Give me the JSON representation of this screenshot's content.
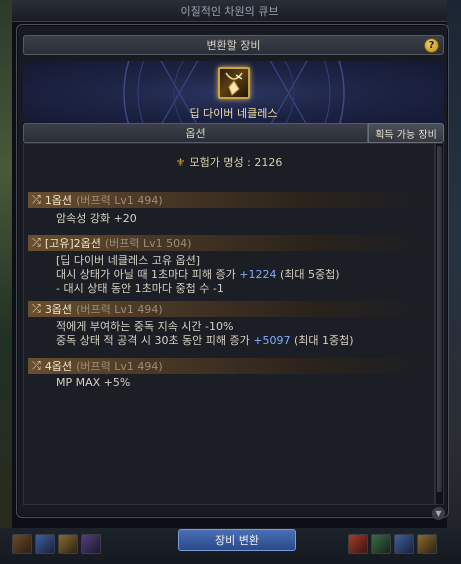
{
  "window": {
    "title": "이질적인 차원의 큐브"
  },
  "convert_section": {
    "title": "변환할 장비",
    "help_label": "?"
  },
  "equipment": {
    "name": "딥 다이버 네클레스",
    "icon": "necklace-icon"
  },
  "tabs": {
    "options_label": "옵션",
    "acquire_label": "획득 가능 장비"
  },
  "fame": {
    "label": "모험가 명성 : 2126",
    "icon": "crest-icon"
  },
  "options": [
    {
      "title": "1옵션",
      "meta": "(버프력 Lv1 494)",
      "lines": [
        {
          "pre": "암속성 강화 +20",
          "hl": "",
          "post": ""
        }
      ]
    },
    {
      "title": "[고유]2옵션",
      "meta": "(버프력 Lv1 504)",
      "lines": [
        {
          "pre": "[딥 다이버 네클레스 고유 옵션]",
          "hl": "",
          "post": ""
        },
        {
          "pre": "대시 상태가 아닐 때 1초마다 피해 증가 ",
          "hl": "+1224",
          "post": " (최대 5중첩)"
        },
        {
          "pre": "- 대시 상태 동안 1초마다 중첩 수 -1",
          "hl": "",
          "post": ""
        }
      ]
    },
    {
      "title": "3옵션",
      "meta": "(버프력 Lv1 494)",
      "lines": [
        {
          "pre": "적에게 부여하는 중독 지속 시간 -10%",
          "hl": "",
          "post": ""
        },
        {
          "pre": "중독 상태 적 공격 시 30초 동안 피해 증가 ",
          "hl": "+5097",
          "post": " (최대 1중첩)"
        }
      ]
    },
    {
      "title": "4옵션",
      "meta": "(버프력 Lv1 494)",
      "lines": [
        {
          "pre": "MP MAX +5%",
          "hl": "",
          "post": ""
        }
      ]
    }
  ],
  "footer": {
    "convert_button": "장비 변환"
  },
  "colors": {
    "highlight": "#7fb0ff",
    "gold": "#f0dfa8",
    "panel": "#1b1e25"
  }
}
